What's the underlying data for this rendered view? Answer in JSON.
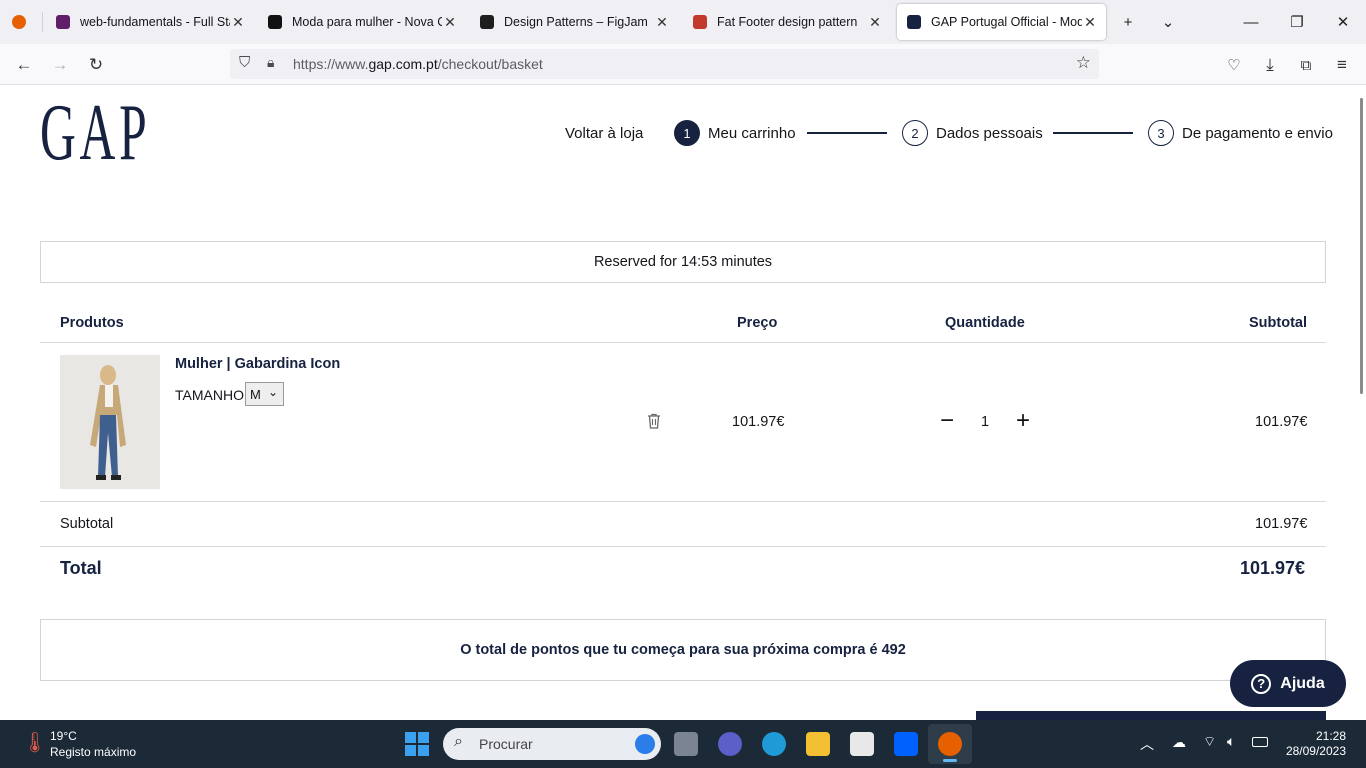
{
  "browser": {
    "tabs": [
      {
        "title": "web-fundamentals - Full Stac",
        "favicon_color": "#611f69"
      },
      {
        "title": "Moda para mulher - Nova Co",
        "favicon_color": "#111111"
      },
      {
        "title": "Design Patterns – FigJam",
        "favicon_color": "#1e1e1e"
      },
      {
        "title": "Fat Footer design pattern",
        "favicon_color": "#c0392b"
      },
      {
        "title": "GAP Portugal Official - Moda",
        "favicon_color": "#162240"
      }
    ],
    "url_prefix": "https://www.",
    "url_domain": "gap.com.pt",
    "url_path": "/checkout/basket"
  },
  "header": {
    "logo": "GAP",
    "back_label": "Voltar à loja",
    "steps": [
      {
        "num": "1",
        "label": "Meu carrinho"
      },
      {
        "num": "2",
        "label": "Dados pessoais"
      },
      {
        "num": "3",
        "label": "De pagamento e envio"
      }
    ]
  },
  "reserved_text": "Reserved for 14:53 minutes",
  "table": {
    "headers": {
      "products": "Produtos",
      "price": "Preço",
      "quantity": "Quantidade",
      "subtotal": "Subtotal"
    },
    "item": {
      "name": "Mulher | Gabardina Icon",
      "size_label": "TAMANHO",
      "size_value": "M",
      "price": "101.97€",
      "quantity": "1",
      "subtotal": "101.97€"
    }
  },
  "summary": {
    "subtotal_label": "Subtotal",
    "subtotal_value": "101.97€",
    "total_label": "Total",
    "total_value": "101.97€"
  },
  "points_text": "O total de pontos que tu começa para sua próxima compra é 492",
  "help_label": "Ajuda",
  "taskbar": {
    "temperature": "19°C",
    "weather_desc": "Registo máximo",
    "search_placeholder": "Procurar",
    "time": "21:28",
    "date": "28/09/2023"
  }
}
